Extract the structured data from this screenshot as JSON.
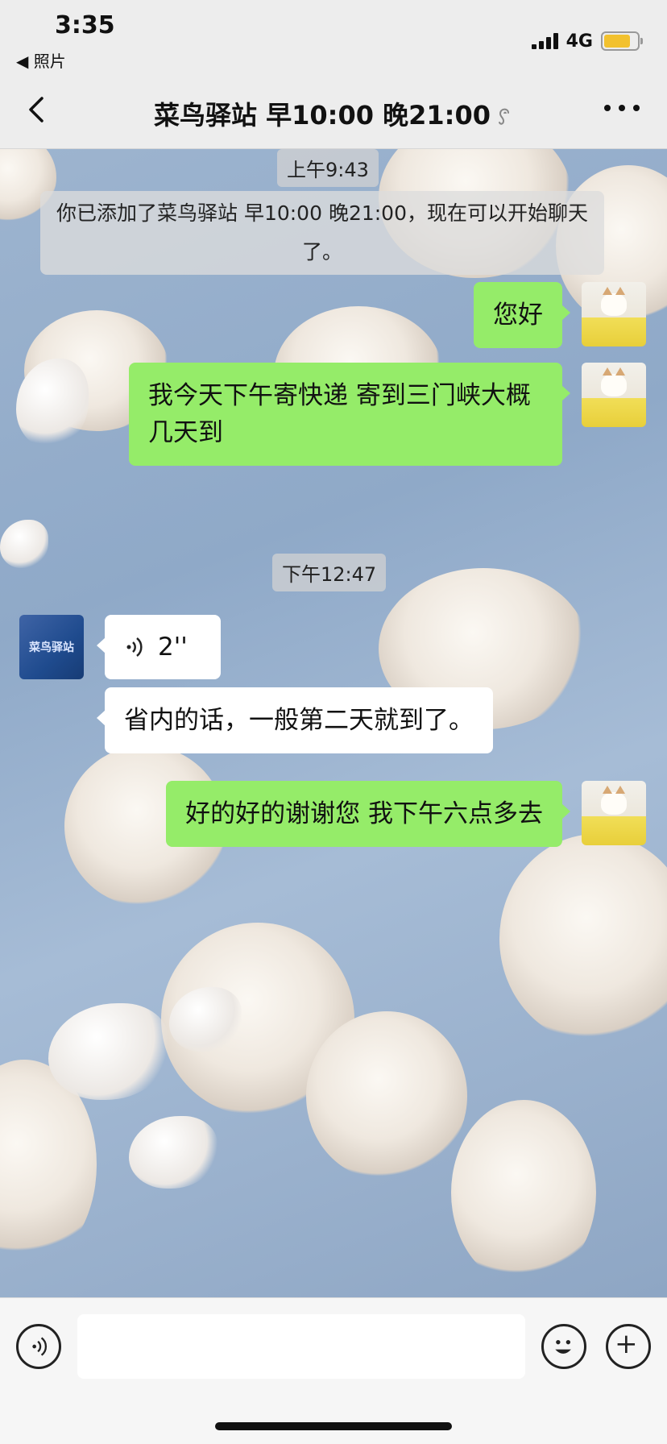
{
  "status_bar": {
    "time": "3:35",
    "back_app": "◀ 照片",
    "network": "4G",
    "battery_level_pct": 80,
    "battery_color": "#f2c12e"
  },
  "nav": {
    "title": "菜鸟驿站 早10:00 晚21:00",
    "back_icon": "chevron-left-icon",
    "earpiece_icon": "ear-icon",
    "more_icon": "more-dots-icon"
  },
  "chat": {
    "timestamps": [
      "上午9:43",
      "下午12:47"
    ],
    "system_message": "你已添加了菜鸟驿站 早10:00 晚21:00，现在可以开始聊天了。",
    "messages": [
      {
        "from": "me",
        "text": "您好"
      },
      {
        "from": "me",
        "text": "我今天下午寄快递 寄到三门峡大概几天到"
      },
      {
        "from": "other",
        "type": "voice",
        "duration": "2''"
      },
      {
        "from": "other",
        "text": "省内的话，一般第二天就到了。"
      },
      {
        "from": "me",
        "text": "好的好的谢谢您 我下午六点多去"
      }
    ],
    "other_avatar_text": "菜鸟驿站",
    "colors": {
      "my_bubble": "#95ec69",
      "other_bubble": "#ffffff"
    }
  },
  "input_bar": {
    "placeholder": "",
    "icons": [
      "voice-icon",
      "emoji-icon",
      "plus-icon"
    ]
  }
}
